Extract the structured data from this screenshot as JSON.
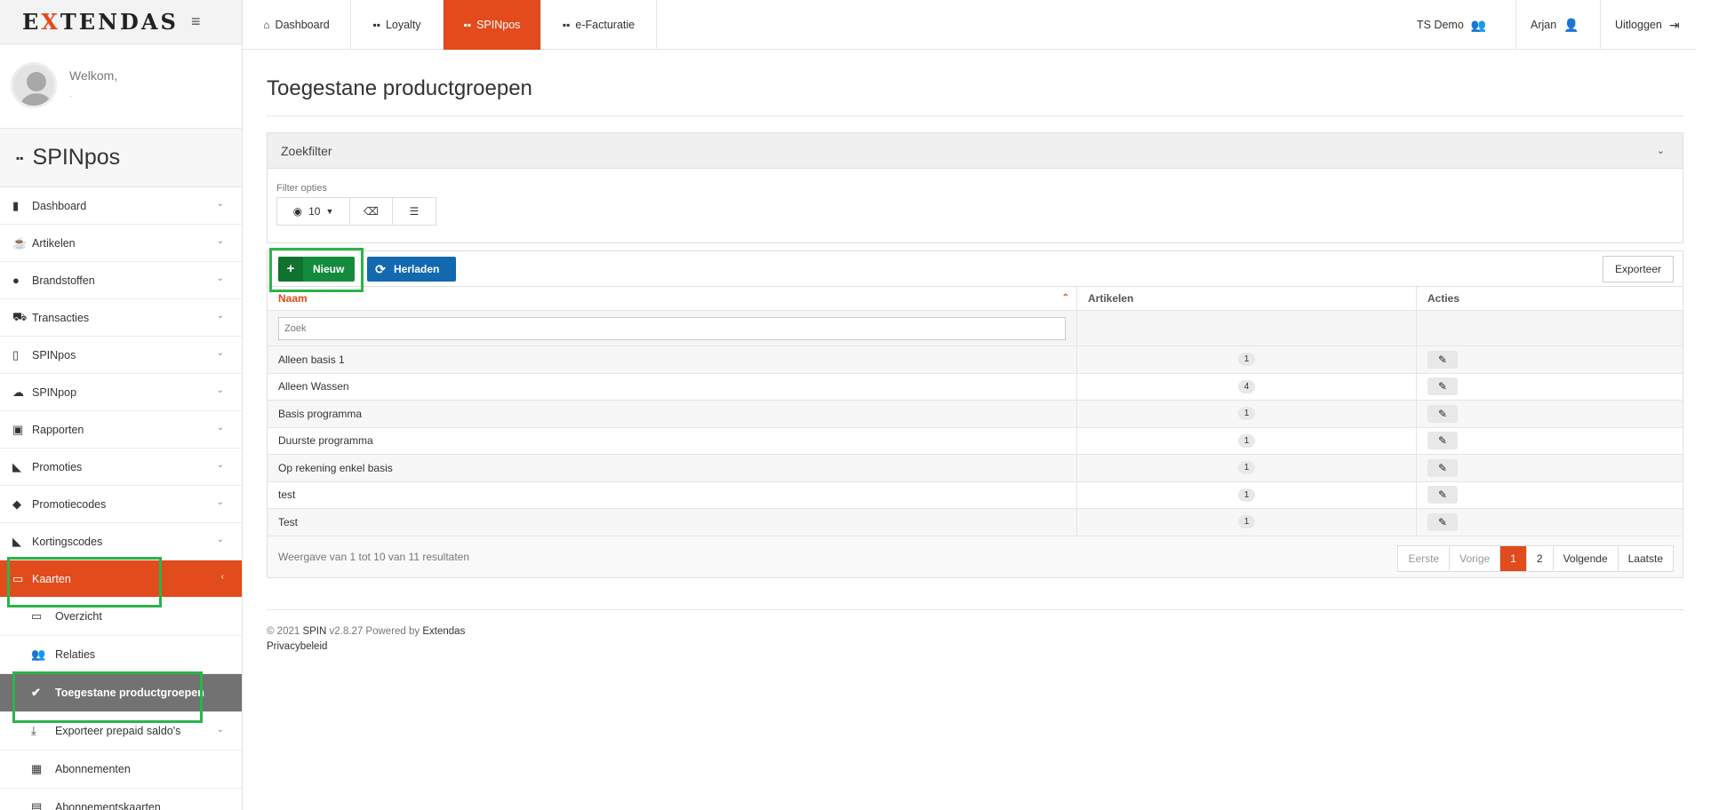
{
  "brand": {
    "logo_pre": "E",
    "logo_x": "X",
    "logo_post": "TENDAS",
    "menu_icon": "hamburger-icon"
  },
  "user": {
    "welcome": "Welkom,",
    "name": "."
  },
  "module": {
    "title": "SPINpos"
  },
  "sidebar": {
    "items": [
      {
        "label": "Dashboard",
        "icon": "bar-chart-icon"
      },
      {
        "label": "Artikelen",
        "icon": "coffee-cup-icon"
      },
      {
        "label": "Brandstoffen",
        "icon": "drop-icon"
      },
      {
        "label": "Transacties",
        "icon": "cart-icon"
      },
      {
        "label": "SPINpos",
        "icon": "mobile-icon"
      },
      {
        "label": "SPINpop",
        "icon": "cloud-upload-icon"
      },
      {
        "label": "Rapporten",
        "icon": "inbox-icon"
      },
      {
        "label": "Promoties",
        "icon": "megaphone-icon"
      },
      {
        "label": "Promotiecodes",
        "icon": "tag-icon"
      },
      {
        "label": "Kortingscodes",
        "icon": "megaphone-icon"
      },
      {
        "label": "Kaarten",
        "icon": "credit-card-icon"
      }
    ],
    "sub_items": [
      {
        "label": "Overzicht",
        "icon": "credit-card-icon"
      },
      {
        "label": "Relaties",
        "icon": "users-icon"
      },
      {
        "label": "Toegestane productgroepen",
        "icon": "check-circle-icon"
      },
      {
        "label": "Exporteer prepaid saldo's",
        "icon": "download-icon"
      },
      {
        "label": "Abonnementen",
        "icon": "calendar-icon"
      },
      {
        "label": "Abonnementskaarten",
        "icon": "id-card-icon"
      }
    ]
  },
  "topnav": {
    "tabs": [
      {
        "label": "Dashboard",
        "icon": "home-icon"
      },
      {
        "label": "Loyalty",
        "icon": "grid-icon"
      },
      {
        "label": "SPINpos",
        "icon": "grid-icon"
      },
      {
        "label": "e-Facturatie",
        "icon": "grid-icon"
      }
    ],
    "company": "TS Demo",
    "user": "Arjan",
    "logout": "Uitloggen"
  },
  "page": {
    "title": "Toegestane productgroepen"
  },
  "filter": {
    "panel_title": "Zoekfilter",
    "options_label": "Filter opties",
    "page_size": "10"
  },
  "toolbar": {
    "new_label": "Nieuw",
    "reload_label": "Herladen",
    "export_label": "Exporteer"
  },
  "table": {
    "columns": [
      "Naam",
      "Artikelen",
      "Acties"
    ],
    "search_placeholder": "Zoek",
    "rows": [
      {
        "name": "Alleen basis 1",
        "count": "1"
      },
      {
        "name": "Alleen Wassen",
        "count": "4"
      },
      {
        "name": "Basis programma",
        "count": "1"
      },
      {
        "name": "Duurste programma",
        "count": "1"
      },
      {
        "name": "Op rekening enkel basis",
        "count": "1"
      },
      {
        "name": "test",
        "count": "1"
      },
      {
        "name": "Test",
        "count": "1"
      }
    ],
    "summary": "Weergave van 1 tot 10 van 11 resultaten"
  },
  "pagination": {
    "first": "Eerste",
    "prev": "Vorige",
    "pages": [
      "1",
      "2"
    ],
    "next": "Volgende",
    "last": "Laatste"
  },
  "footer": {
    "copyright": "© 2021",
    "product": "SPIN",
    "version": "v2.8.27 Powered by",
    "company": "Extendas",
    "privacy": "Privacybeleid"
  },
  "colors": {
    "accent": "#e24b1b",
    "new_button": "#148a3c",
    "reload_button": "#1269b0",
    "highlight_box": "#2db34a"
  }
}
